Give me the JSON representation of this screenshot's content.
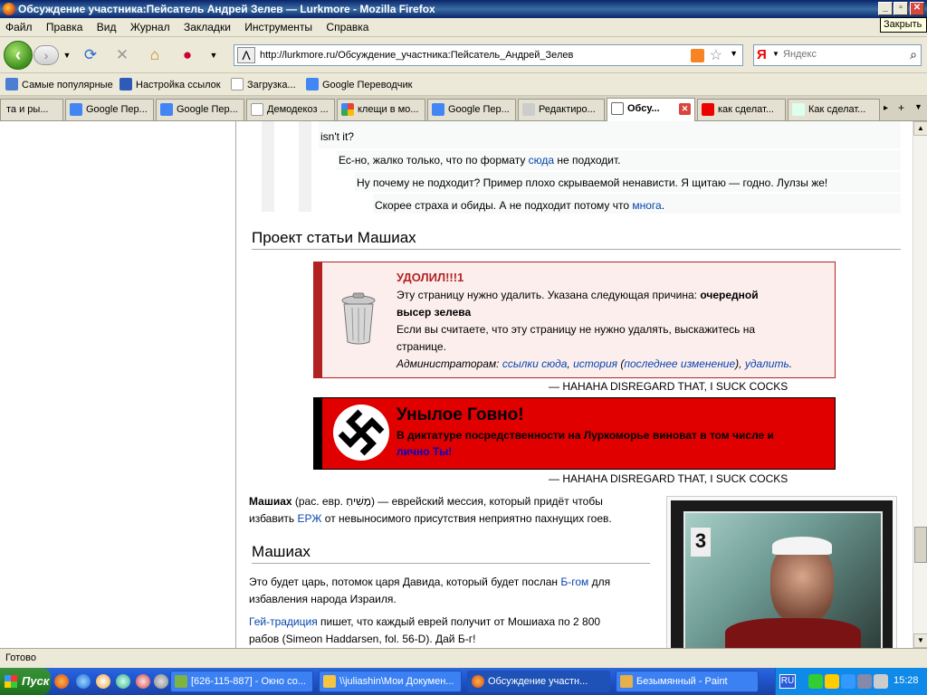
{
  "window": {
    "title": "Обсуждение участника:Пейсатель Андрей Зелев — Lurkmore - Mozilla Firefox",
    "tooltip": "Закрыть"
  },
  "menu": [
    "Файл",
    "Правка",
    "Вид",
    "Журнал",
    "Закладки",
    "Инструменты",
    "Справка"
  ],
  "nav": {
    "url": "http://lurkmore.ru/Обсуждение_участника:Пейсатель_Андрей_Зелев",
    "search_placeholder": "Яндекс",
    "search_engine_glyph": "Я"
  },
  "bookmarks": [
    "Самые популярные",
    "Настройка ссылок",
    "Загрузка...",
    "Google Переводчик"
  ],
  "tabs": [
    "та и ры...",
    "Google Пер...",
    "Google Пер...",
    "Демодекоз ...",
    "клещи в мо...",
    "Google Пер...",
    "Редактиро...",
    "Обсу...",
    "как сделат...",
    "Как сделат..."
  ],
  "content": {
    "dialog_top": "isn't it?",
    "reply1": {
      "pre": "Ес-но, жалко только, что по формату ",
      "link": "сюда",
      "post": " не подходит."
    },
    "reply2": "Ну почему не подходит? Пример плохо скрываемой ненависти. Я щитаю — годно. Лулзы же!",
    "reply3": {
      "pre": "Скорее страха и обиды. А не подходит потому что ",
      "link": "многа",
      "post": "."
    },
    "section1": "Проект статьи Машиах",
    "delete_box": {
      "title": "УДОЛИЛ!!!1",
      "line1_pre": "Эту страницу нужно удалить. Указана следующая причина: ",
      "line1_bold": "очередной",
      "line2_bold": "высер зелева",
      "line3": "Если вы считаете, что эту страницу не нужно удалять, выскажитесь на",
      "line4": "странице.",
      "admin_pre": "Администраторам: ",
      "admin_links": [
        "ссылки сюда",
        "история",
        "последнее изменение",
        "удалить"
      ]
    },
    "quote": "— HAHAHA DISREGARD THAT, I SUCK COCKS",
    "boring_box": {
      "title": "Унылое Говно!",
      "line1": "В диктатуре посредственности на Луркоморье виноват в том числе и",
      "line2": "лично Ты!"
    },
    "intro": {
      "bold": "Машиах",
      "pre": " (рас. евр. ",
      "hebrew": "מָשִׁיחַ",
      "mid": ") — еврейский мессия, который придёт чтобы",
      "line2_pre": "избавить ",
      "erzh": "ЕРЖ",
      "line2_post": " от невыносимого присутствия неприятно пахнущих гоев."
    },
    "section2": "Машиах",
    "para1_pre": "Это будет царь, потомок царя Давида, который будет послан ",
    "para1_link": "Б-гом",
    "para1_post": " для",
    "para1_line2": "избавления народа Израиля.",
    "para2_link": "Гей-традиция",
    "para2_post": " пишет, что каждый еврей получит от Мошиаха по 2 800",
    "para2_line2": "рабов (Simeon Haddarsen, fol. 56-D). Дай Б-г!",
    "photo_number": "3"
  },
  "status": "Готово",
  "taskbar": {
    "start": "Пуск",
    "buttons": [
      "[626-115-887] - Окно со...",
      "\\\\juliashin\\Мои Докумен...",
      "Обсуждение участн...",
      "Безымянный - Paint"
    ],
    "lang": "RU",
    "clock": "15:28"
  },
  "colors": {
    "link": "#0645ad",
    "delete_red": "#b22222",
    "boring_red": "#e00000",
    "boring_title": "#000000"
  }
}
